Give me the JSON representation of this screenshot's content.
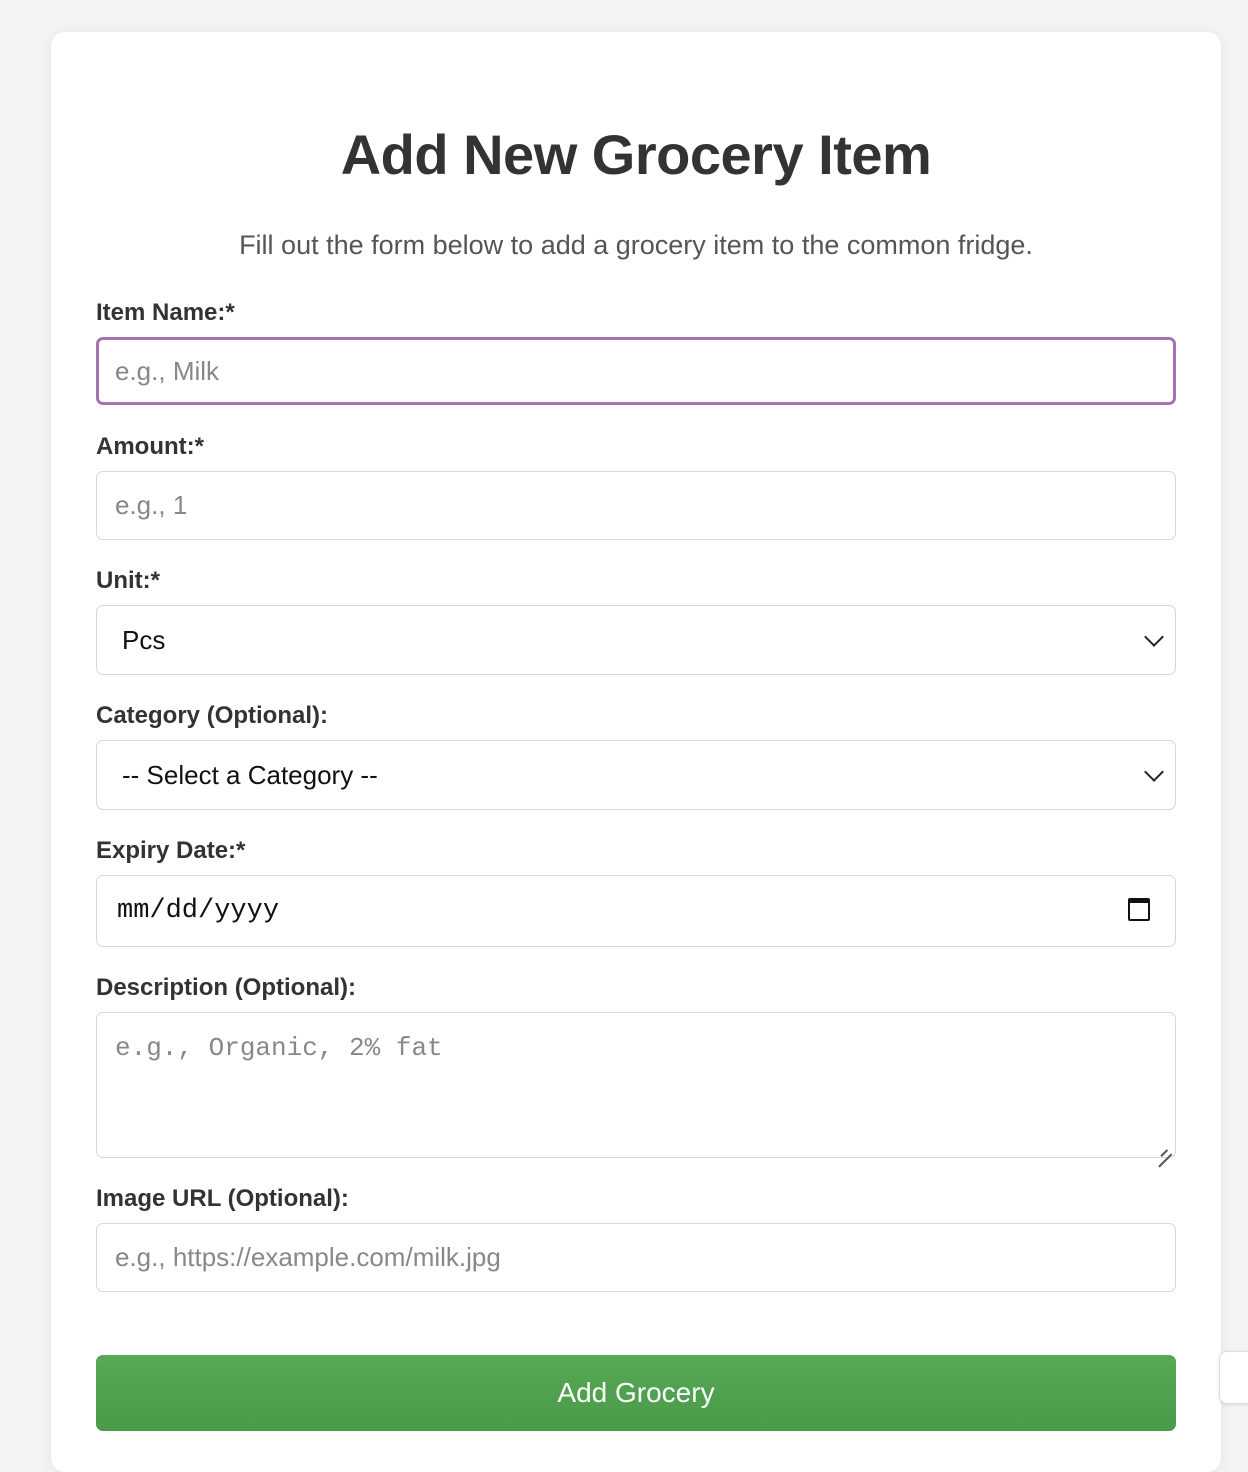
{
  "form": {
    "title": "Add New Grocery Item",
    "subtitle": "Fill out the form below to add a grocery item to the common fridge.",
    "item_name": {
      "label": "Item Name:*",
      "placeholder": "e.g., Milk"
    },
    "amount": {
      "label": "Amount:*",
      "placeholder": "e.g., 1"
    },
    "unit": {
      "label": "Unit:*",
      "value": "Pcs"
    },
    "category": {
      "label": "Category (Optional):",
      "value": "-- Select a Category --"
    },
    "expiry": {
      "label": "Expiry Date:*",
      "value": "mm/dd/yyyy"
    },
    "description": {
      "label": "Description (Optional):",
      "placeholder": "e.g., Organic, 2% fat"
    },
    "image_url": {
      "label": "Image URL (Optional):",
      "placeholder": "e.g., https://example.com/milk.jpg"
    },
    "submit_label": "Add Grocery"
  },
  "colors": {
    "focus_border": "#a574b0",
    "button": "#52a352"
  }
}
